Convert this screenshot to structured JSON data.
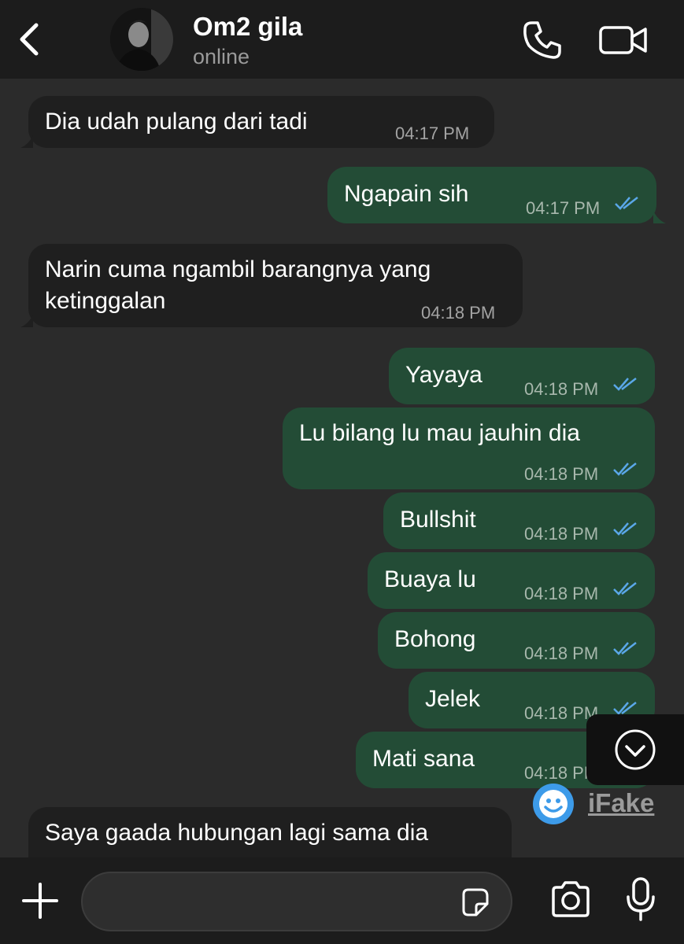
{
  "header": {
    "contact_name": "Om2 gila",
    "status": "online",
    "back_icon": "chevron-left-icon",
    "call_icon": "phone-icon",
    "video_icon": "video-camera-icon"
  },
  "messages": [
    {
      "direction": "in",
      "text": "Dia udah pulang dari tadi",
      "time": "04:17 PM"
    },
    {
      "direction": "out",
      "text": "Ngapain sih",
      "time": "04:17 PM",
      "status": "read"
    },
    {
      "direction": "in",
      "text": [
        "Narin cuma ngambil barangnya yang",
        "ketinggalan"
      ],
      "time": "04:18 PM"
    },
    {
      "direction": "out",
      "text": "Yayaya",
      "time": "04:18 PM",
      "status": "read"
    },
    {
      "direction": "out",
      "text": "Lu bilang lu mau jauhin dia",
      "time": "04:18 PM",
      "status": "read"
    },
    {
      "direction": "out",
      "text": "Bullshit",
      "time": "04:18 PM",
      "status": "read"
    },
    {
      "direction": "out",
      "text": "Buaya lu",
      "time": "04:18 PM",
      "status": "read"
    },
    {
      "direction": "out",
      "text": "Bohong",
      "time": "04:18 PM",
      "status": "read"
    },
    {
      "direction": "out",
      "text": "Jelek",
      "time": "04:18 PM",
      "status": "read"
    },
    {
      "direction": "out",
      "text": "Mati sana",
      "time": "04:18 PM",
      "status": "read"
    },
    {
      "direction": "in",
      "text": "Saya gaada hubungan lagi sama dia",
      "time": ""
    }
  ],
  "watermark": {
    "text": "iFake",
    "icon": "ifake-logo-icon"
  },
  "composer": {
    "placeholder": "",
    "plus_icon": "plus-icon",
    "sticker_icon": "sticker-icon",
    "camera_icon": "camera-icon",
    "mic_icon": "microphone-icon"
  },
  "colors": {
    "background": "#2b2b2b",
    "header": "#1c1c1c",
    "incoming_bubble": "#1f1f1f",
    "outgoing_bubble": "#234c36",
    "read_ticks": "#5aa7e8"
  }
}
